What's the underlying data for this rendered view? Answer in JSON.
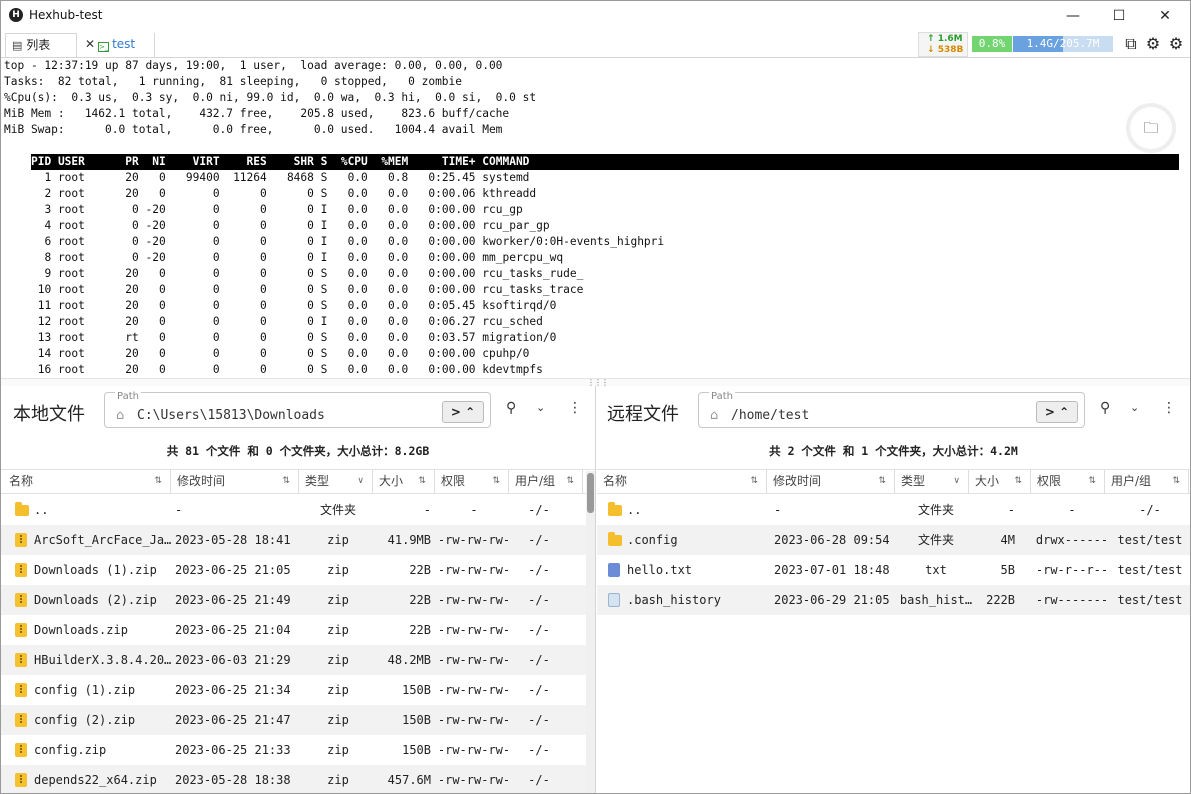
{
  "window": {
    "title": "Hexhub-test",
    "logo": "H"
  },
  "tabs": [
    {
      "label": "列表",
      "icon": "list-icon"
    },
    {
      "label": "test",
      "icon": "terminal-icon"
    }
  ],
  "status": {
    "net_up": "1.6M",
    "net_down": "538B",
    "cpu": "0.8%",
    "mem": "1.4G/205.7M",
    "mem_fraction": 0.5
  },
  "terminal": {
    "lines": [
      "top - 12:37:19 up 87 days, 19:00,  1 user,  load average: 0.00, 0.00, 0.00",
      "Tasks:  82 total,   1 running,  81 sleeping,   0 stopped,   0 zombie",
      "%Cpu(s):  0.3 us,  0.3 sy,  0.0 ni, 99.0 id,  0.0 wa,  0.3 hi,  0.0 si,  0.0 st",
      "MiB Mem :   1462.1 total,    432.7 free,    205.8 used,    823.6 buff/cache",
      "MiB Swap:      0.0 total,      0.0 free,      0.0 used.   1004.4 avail Mem",
      ""
    ],
    "table_header": "PID USER      PR  NI    VIRT    RES    SHR S  %CPU  %MEM     TIME+ COMMAND",
    "processes": [
      "  1 root      20   0   99400  11264   8468 S   0.0   0.8   0:25.45 systemd",
      "  2 root      20   0       0      0      0 S   0.0   0.0   0:00.06 kthreadd",
      "  3 root       0 -20       0      0      0 I   0.0   0.0   0:00.00 rcu_gp",
      "  4 root       0 -20       0      0      0 I   0.0   0.0   0:00.00 rcu_par_gp",
      "  6 root       0 -20       0      0      0 I   0.0   0.0   0:00.00 kworker/0:0H-events_highpri",
      "  8 root       0 -20       0      0      0 I   0.0   0.0   0:00.00 mm_percpu_wq",
      "  9 root      20   0       0      0      0 S   0.0   0.0   0:00.00 rcu_tasks_rude_",
      " 10 root      20   0       0      0      0 S   0.0   0.0   0:00.00 rcu_tasks_trace",
      " 11 root      20   0       0      0      0 S   0.0   0.0   0:05.45 ksoftirqd/0",
      " 12 root      20   0       0      0      0 I   0.0   0.0   0:06.27 rcu_sched",
      " 13 root      rt   0       0      0      0 S   0.0   0.0   0:03.57 migration/0",
      " 14 root      20   0       0      0      0 S   0.0   0.0   0:00.00 cpuhp/0",
      " 16 root      20   0       0      0      0 S   0.0   0.0   0:00.00 kdevtmpfs"
    ]
  },
  "local": {
    "title": "本地文件",
    "path_label": "Path",
    "path": "C:\\Users\\15813\\Downloads",
    "summary": "共 81 个文件 和 0 个文件夹，大小总计：8.2GB",
    "columns": [
      "名称",
      "修改时间",
      "类型",
      "大小",
      "权限",
      "用户/组"
    ],
    "files": [
      {
        "name": "..",
        "time": "-",
        "type": "文件夹",
        "size": "-",
        "perm": "-",
        "owner": "-/-",
        "icon": "folder"
      },
      {
        "name": "ArcSoft_ArcFace_Ja…",
        "time": "2023-05-28 18:41",
        "type": "zip",
        "size": "41.9MB",
        "perm": "-rw-rw-rw-",
        "owner": "-/-",
        "icon": "zip"
      },
      {
        "name": "Downloads (1).zip",
        "time": "2023-06-25 21:05",
        "type": "zip",
        "size": "22B",
        "perm": "-rw-rw-rw-",
        "owner": "-/-",
        "icon": "zip"
      },
      {
        "name": "Downloads (2).zip",
        "time": "2023-06-25 21:49",
        "type": "zip",
        "size": "22B",
        "perm": "-rw-rw-rw-",
        "owner": "-/-",
        "icon": "zip"
      },
      {
        "name": "Downloads.zip",
        "time": "2023-06-25 21:04",
        "type": "zip",
        "size": "22B",
        "perm": "-rw-rw-rw-",
        "owner": "-/-",
        "icon": "zip"
      },
      {
        "name": "HBuilderX.3.8.4.20…",
        "time": "2023-06-03 21:29",
        "type": "zip",
        "size": "48.2MB",
        "perm": "-rw-rw-rw-",
        "owner": "-/-",
        "icon": "zip"
      },
      {
        "name": "config (1).zip",
        "time": "2023-06-25 21:34",
        "type": "zip",
        "size": "150B",
        "perm": "-rw-rw-rw-",
        "owner": "-/-",
        "icon": "zip"
      },
      {
        "name": "config (2).zip",
        "time": "2023-06-25 21:47",
        "type": "zip",
        "size": "150B",
        "perm": "-rw-rw-rw-",
        "owner": "-/-",
        "icon": "zip"
      },
      {
        "name": "config.zip",
        "time": "2023-06-25 21:33",
        "type": "zip",
        "size": "150B",
        "perm": "-rw-rw-rw-",
        "owner": "-/-",
        "icon": "zip"
      },
      {
        "name": "depends22_x64.zip",
        "time": "2023-05-28 18:38",
        "type": "zip",
        "size": "457.6M",
        "perm": "-rw-rw-rw-",
        "owner": "-/-",
        "icon": "zip"
      }
    ]
  },
  "remote": {
    "title": "远程文件",
    "path_label": "Path",
    "path": "/home/test",
    "summary": "共 2 个文件 和 1 个文件夹，大小总计：4.2M",
    "columns": [
      "名称",
      "修改时间",
      "类型",
      "大小",
      "权限",
      "用户/组"
    ],
    "files": [
      {
        "name": "..",
        "time": "-",
        "type": "文件夹",
        "size": "-",
        "perm": "-",
        "owner": "-/-",
        "icon": "folder"
      },
      {
        "name": ".config",
        "time": "2023-06-28 09:54",
        "type": "文件夹",
        "size": "4M",
        "perm": "drwx------",
        "owner": "test/test",
        "icon": "folder"
      },
      {
        "name": "hello.txt",
        "time": "2023-07-01 18:48",
        "type": "txt",
        "size": "5B",
        "perm": "-rw-r--r--",
        "owner": "test/test",
        "icon": "txt"
      },
      {
        "name": ".bash_history",
        "time": "2023-06-29 21:05",
        "type": "bash_hist…",
        "size": "222B",
        "perm": "-rw-------",
        "owner": "test/test",
        "icon": "hist"
      }
    ]
  }
}
